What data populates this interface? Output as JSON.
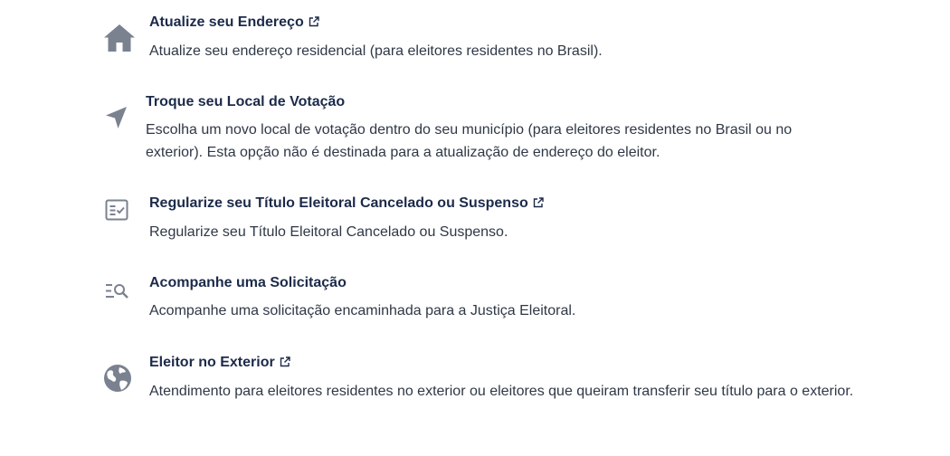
{
  "colors": {
    "title": "#1c2a4a",
    "text": "#2f3846",
    "icon": "#7a8290",
    "background": "#ffffff"
  },
  "services": [
    {
      "icon": "home-icon",
      "title": "Atualize seu Endereço",
      "external": true,
      "description": "Atualize seu endereço residencial (para eleitores residentes no Brasil)."
    },
    {
      "icon": "navigation-arrow-icon",
      "title": "Troque seu Local de Votação",
      "external": false,
      "description": "Escolha um novo local de votação dentro do seu município (para eleitores residentes no Brasil ou no exterior). Esta opção não é destinada para a atualização de endereço do eleitor."
    },
    {
      "icon": "checklist-document-icon",
      "title": "Regularize seu Título Eleitoral Cancelado ou Suspenso",
      "external": true,
      "description": "Regularize seu Título Eleitoral Cancelado ou Suspenso."
    },
    {
      "icon": "list-search-icon",
      "title": "Acompanhe uma Solicitação",
      "external": false,
      "description": "Acompanhe uma solicitação encaminhada para a Justiça Eleitoral."
    },
    {
      "icon": "globe-icon",
      "title": "Eleitor no Exterior",
      "external": true,
      "description": "Atendimento para eleitores residentes no exterior ou eleitores que queiram transferir seu título para o exterior."
    }
  ]
}
